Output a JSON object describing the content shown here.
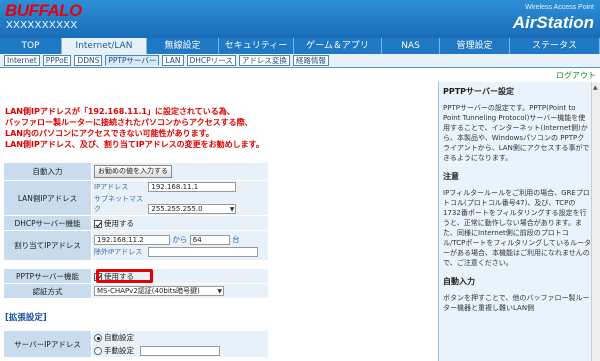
{
  "header": {
    "brand": "BUFFALO",
    "model": "XXXXXXXXXX",
    "product_sub": "Wireless Access Point",
    "product_main": "AirStation"
  },
  "main_tabs": [
    {
      "label": "TOP",
      "w": 62
    },
    {
      "label": "Internet/LAN",
      "w": 85,
      "active": true
    },
    {
      "label": "無線設定",
      "w": 72
    },
    {
      "label": "セキュリティー",
      "w": 75
    },
    {
      "label": "ゲーム＆アプリ",
      "w": 88
    },
    {
      "label": "NAS",
      "w": 58
    },
    {
      "label": "管理設定",
      "w": 70
    },
    {
      "label": "ステータス",
      "w": 90
    }
  ],
  "sub_tabs": [
    {
      "label": "Internet"
    },
    {
      "label": "PPPoE"
    },
    {
      "label": "DDNS"
    },
    {
      "label": "PPTPサーバー",
      "active": true
    },
    {
      "label": "LAN"
    },
    {
      "label": "DHCPリース"
    },
    {
      "label": "アドレス変換"
    },
    {
      "label": "経路情報"
    }
  ],
  "logout": "ログアウト",
  "warning": [
    "LAN側IPアドレスが「192.168.11.1」に設定されている為、",
    "バッファロー製ルーターに接続されたパソコンからアクセスする際、",
    "LAN内のパソコンにアクセスできない可能性があります。",
    "LAN側IPアドレス、及び、割り当てIPアドレスの変更をお勧めします。"
  ],
  "form": {
    "auto_input_label": "自動入力",
    "auto_input_button": "お勧めの値を入力する",
    "lan_ip_label": "LAN側IPアドレス",
    "ip_address_label": "IPアドレス",
    "ip_address_value": "192.168.11.1",
    "subnet_label": "サブネットマスク",
    "subnet_value": "255.255.255.0",
    "dhcp_label": "DHCPサーバー機能",
    "dhcp_checkbox": "使用する",
    "assign_label": "割り当てIPアドレス",
    "assign_start": "192.168.11.2",
    "assign_from": "から",
    "assign_count": "64",
    "assign_unit": "台",
    "exclude_label": "除外IPアドレス",
    "pptp_label": "PPTPサーバー機能",
    "pptp_checkbox": "使用する",
    "auth_label": "認証方式",
    "auth_value": "MS-CHAPv2認証(40bits暗号鍵)"
  },
  "advanced": {
    "title": "[拡張設定]",
    "server_ip_label": "サーバーIPアドレス",
    "auto_radio": "自動設定",
    "manual_radio": "手動設定"
  },
  "help": {
    "title": "PPTPサーバー設定",
    "intro": "PPTPサーバーの設定です。PPTP(Point to Point Tunneling Protocol)サーバー機能を使用することで、インターネット(Internet側)から、本製品や、Windowsパソコンの PPTPクライアントから、LAN側にアクセスする事ができるようになります。",
    "note_title": "注意",
    "note": "IPフィルタールールをご利用の場合、GREプロトコル(プロトコル番号47)、及び、TCPの1732番ポートをフィルタリングする設定を行うと、正常に動作しない場合があります。また、同様にInternet側に前段のプロトコル/TCPポートをフィルタリングしているルーターがある場合、本機能はご利用になれませんので、ご注意ください。",
    "auto_title": "自動入力",
    "auto_text": "ボタンを押すことで、他のバッファロー製ルーター機器と重複し難いLAN側"
  }
}
